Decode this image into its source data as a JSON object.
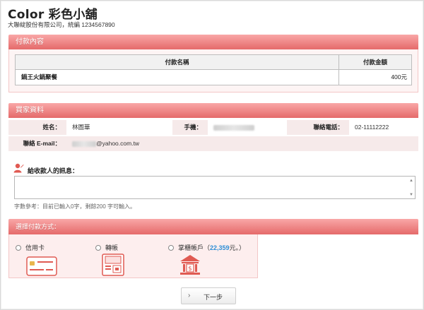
{
  "header": {
    "shop_title": "Color 彩色小舖",
    "company": "大聯綻股份有限公司，統編 1234567890"
  },
  "payment_section": {
    "title": "付款內容",
    "columns": [
      "付款名稱",
      "付款金額"
    ],
    "rows": [
      {
        "name": "鍋王火鍋聚餐",
        "amount": "400元"
      }
    ]
  },
  "buyer_section": {
    "title": "買家資料",
    "name_label": "姓名：",
    "name_value": "林圖華",
    "phone_label": "手機：",
    "tel_label": "聯絡電話：",
    "tel_value": "02-11112222",
    "email_label": "聯絡 E-mail：",
    "email_value": "@yahoo.com.tw"
  },
  "message": {
    "label": "給收款人的訊息：",
    "value": "",
    "hint": "字數參考：目前已輸入0字，剩餘200 字可輸入。"
  },
  "payment_methods": {
    "title": "選擇付款方式：",
    "options": [
      {
        "label": "信用卡"
      },
      {
        "label": "轉帳"
      },
      {
        "label": "掌櫃帳戶（",
        "amount": "22,359",
        "suffix": "元。）"
      }
    ]
  },
  "actions": {
    "next_label": "下一步"
  },
  "colors": {
    "header_gradient_top": "#f9a7a7",
    "header_gradient_bottom": "#e56a6a",
    "amount": "#2f8fd6"
  }
}
